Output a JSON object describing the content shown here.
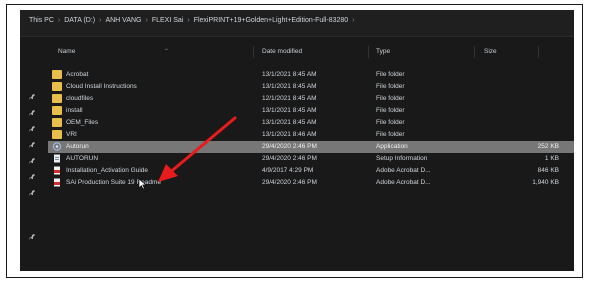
{
  "breadcrumb": [
    "This PC",
    "DATA (D:)",
    "ANH VANG",
    "FLEXI Sai",
    "FlexiPRINT+19+Golden+Light+Edition-Full-83280"
  ],
  "columns": {
    "name": "Name",
    "date": "Date modified",
    "type": "Type",
    "size": "Size"
  },
  "files": [
    {
      "name": "Acrobat",
      "date": "13/1/2021 8:45 AM",
      "type": "File folder",
      "size": "",
      "icon": "folder-icon"
    },
    {
      "name": "Cloud Install Instructions",
      "date": "13/1/2021 8:45 AM",
      "type": "File folder",
      "size": "",
      "icon": "folder-icon"
    },
    {
      "name": "cloudfiles",
      "date": "12/1/2021 8:45 AM",
      "type": "File folder",
      "size": "",
      "icon": "folder-icon"
    },
    {
      "name": "install",
      "date": "13/1/2021 8:45 AM",
      "type": "File folder",
      "size": "",
      "icon": "folder-icon"
    },
    {
      "name": "OEM_Files",
      "date": "13/1/2021 8:45 AM",
      "type": "File folder",
      "size": "",
      "icon": "folder-icon"
    },
    {
      "name": "VRI",
      "date": "13/1/2021 8:46 AM",
      "type": "File folder",
      "size": "",
      "icon": "folder-icon"
    },
    {
      "name": "Autorun",
      "date": "29/4/2020 2:46 PM",
      "type": "Application",
      "size": "252 KB",
      "icon": "application-icon",
      "selected": true
    },
    {
      "name": "AUTORUN",
      "date": "29/4/2020 2:46 PM",
      "type": "Setup Information",
      "size": "1 KB",
      "icon": "setup-info-icon"
    },
    {
      "name": "Installation_Activation Guide",
      "date": "4/9/2017 4:29 PM",
      "type": "Adobe Acrobat D...",
      "size": "846 KB",
      "icon": "pdf-icon"
    },
    {
      "name": "SAi Production Suite 19 Readme",
      "date": "29/4/2020 2:46 PM",
      "type": "Adobe Acrobat D...",
      "size": "1,940 KB",
      "icon": "pdf-icon"
    }
  ],
  "colors": {
    "explorer_bg": "#191919",
    "selected_row": "#777777",
    "folder": "#e8bf4a",
    "annotation_arrow": "#e81c1c"
  }
}
